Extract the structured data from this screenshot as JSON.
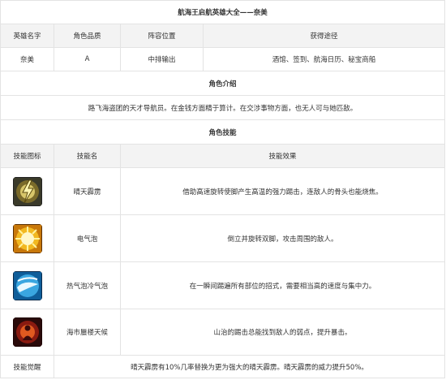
{
  "page_title": "航海王启航英雄大全——奈美",
  "info": {
    "headers": [
      "英雄名字",
      "角色品质",
      "阵容位置",
      "获得途径"
    ],
    "values": [
      "奈美",
      "A",
      "中排输出",
      "酒馆、签到、航海日历、秘宝商船"
    ]
  },
  "intro": {
    "heading": "角色介绍",
    "text": "路飞海盗团的天才导航员。在金钱方面精于算计。在交涉事物方面，也无人可与她匹敌。"
  },
  "skills_section": {
    "heading": "角色技能",
    "headers": [
      "技能图标",
      "技能名",
      "技能效果"
    ],
    "rows": [
      {
        "icon": "lightning-staff-icon",
        "name": "晴天霹雳",
        "effect": "借助高速旋转使脚产生高温的强力踢击，连敌人的骨头也能烧焦。"
      },
      {
        "icon": "electric-bubble-icon",
        "name": "电气泡",
        "effect": "倒立并旋转双脚，攻击周围的敌人。"
      },
      {
        "icon": "hot-cold-bubble-icon",
        "name": "热气泡冷气泡",
        "effect": "在一瞬间踢遍所有部位的招式，需要相当高的速度与集中力。"
      },
      {
        "icon": "mirage-tempo-icon",
        "name": "海市蜃楼天候",
        "effect": "山治的踢击总能找到敌人的弱点，提升暴击。"
      }
    ]
  },
  "awakening": {
    "label": "技能觉醒",
    "text": "晴天霹雳有10%几率替换为更为强大的晴天霹雳。晴天霹雳的威力提升50%。"
  },
  "colors": {
    "border": "#e3e3e3",
    "header_bg": "#f3f3f3"
  }
}
